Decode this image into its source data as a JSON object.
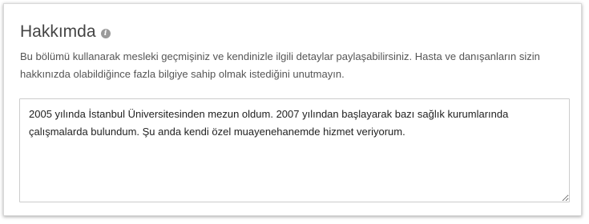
{
  "section": {
    "title": "Hakkımda",
    "info_icon": "info-icon",
    "description": "Bu bölümü kullanarak mesleki geçmişiniz ve kendinizle ilgili detaylar paylaşabilirsiniz. Hasta ve danışanların sizin hakkınızda olabildiğince fazla bilgiye sahip olmak istediğini unutmayın.",
    "about_text": "2005 yılında İstanbul Üniversitesinden mezun oldum. 2007 yılından başlayarak bazı sağlık kurumlarında çalışmalarda bulundum. Şu anda kendi özel muayenehanemde hizmet veriyorum."
  },
  "colors": {
    "title": "#444444",
    "description": "#555555",
    "border": "#cccccc"
  }
}
